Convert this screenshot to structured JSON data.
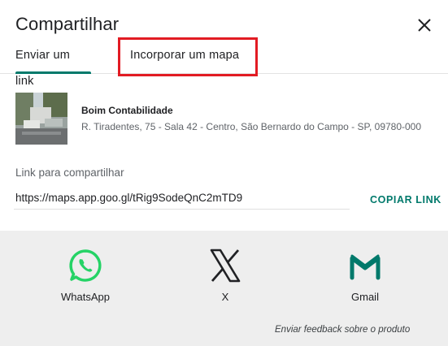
{
  "dialog": {
    "title": "Compartilhar",
    "close_icon": "close-icon"
  },
  "tabs": [
    {
      "label": "Enviar um link",
      "selected": true
    },
    {
      "label": "Incorporar um mapa",
      "selected": false
    }
  ],
  "place": {
    "name": "Boim Contabilidade",
    "address": "R. Tiradentes, 75 - Sala 42 - Centro, São Bernardo do Campo - SP, 09780-000"
  },
  "link": {
    "label": "Link para compartilhar",
    "url": "https://maps.app.goo.gl/tRig9SodeQnC2mTD9",
    "copy_label": "COPIAR LINK"
  },
  "share_options": [
    {
      "label": "WhatsApp",
      "icon": "whatsapp-icon"
    },
    {
      "label": "X",
      "icon": "x-logo-icon"
    },
    {
      "label": "Gmail",
      "icon": "gmail-icon"
    }
  ],
  "feedback": "Enviar feedback sobre o produto",
  "colors": {
    "accent": "#00796b",
    "highlight": "#e21b23",
    "whatsapp": "#25d366",
    "gmail": "#00796b",
    "panel_bg": "#eeeeee"
  }
}
